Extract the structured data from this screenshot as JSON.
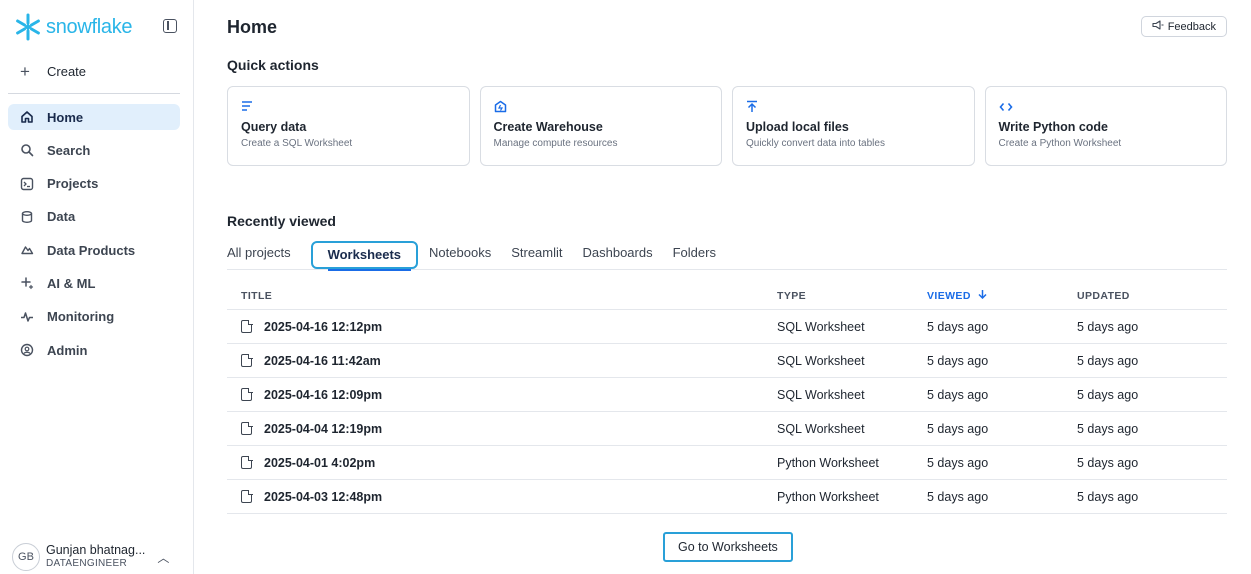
{
  "brand": {
    "logo_text": "snowflake",
    "accent": "#29b5e8"
  },
  "sidebar": {
    "create_label": "Create",
    "items": [
      {
        "label": "Home",
        "icon": "home-icon",
        "active": true
      },
      {
        "label": "Search",
        "icon": "search-icon"
      },
      {
        "label": "Projects",
        "icon": "terminal-icon"
      },
      {
        "label": "Data",
        "icon": "database-icon"
      },
      {
        "label": "Data Products",
        "icon": "cloud-icon"
      },
      {
        "label": "AI & ML",
        "icon": "sparkle-icon"
      },
      {
        "label": "Monitoring",
        "icon": "pulse-icon"
      },
      {
        "label": "Admin",
        "icon": "shield-icon"
      }
    ],
    "user": {
      "initials": "GB",
      "name": "Gunjan bhatnag...",
      "role": "DATAENGINEER"
    }
  },
  "header": {
    "title": "Home",
    "feedback_label": "Feedback"
  },
  "quick_actions": {
    "title": "Quick actions",
    "cards": [
      {
        "icon": "lines-icon",
        "title": "Query data",
        "subtitle": "Create a SQL Worksheet"
      },
      {
        "icon": "warehouse-icon",
        "title": "Create Warehouse",
        "subtitle": "Manage compute resources"
      },
      {
        "icon": "upload-icon",
        "title": "Upload local files",
        "subtitle": "Quickly convert data into tables"
      },
      {
        "icon": "code-icon",
        "title": "Write Python code",
        "subtitle": "Create a Python Worksheet"
      }
    ]
  },
  "recent": {
    "title": "Recently viewed",
    "tabs": [
      "All projects",
      "Worksheets",
      "Notebooks",
      "Streamlit",
      "Dashboards",
      "Folders"
    ],
    "active_tab": "Worksheets",
    "columns": {
      "title": "TITLE",
      "type": "TYPE",
      "viewed": "VIEWED",
      "updated": "UPDATED"
    },
    "rows": [
      {
        "title": "2025-04-16 12:12pm",
        "type": "SQL Worksheet",
        "viewed": "5 days ago",
        "updated": "5 days ago"
      },
      {
        "title": "2025-04-16 11:42am",
        "type": "SQL Worksheet",
        "viewed": "5 days ago",
        "updated": "5 days ago"
      },
      {
        "title": "2025-04-16 12:09pm",
        "type": "SQL Worksheet",
        "viewed": "5 days ago",
        "updated": "5 days ago"
      },
      {
        "title": "2025-04-04 12:19pm",
        "type": "SQL Worksheet",
        "viewed": "5 days ago",
        "updated": "5 days ago"
      },
      {
        "title": "2025-04-01 4:02pm",
        "type": "Python Worksheet",
        "viewed": "5 days ago",
        "updated": "5 days ago"
      },
      {
        "title": "2025-04-03 12:48pm",
        "type": "Python Worksheet",
        "viewed": "5 days ago",
        "updated": "5 days ago"
      }
    ],
    "goto_label": "Go to Worksheets"
  }
}
